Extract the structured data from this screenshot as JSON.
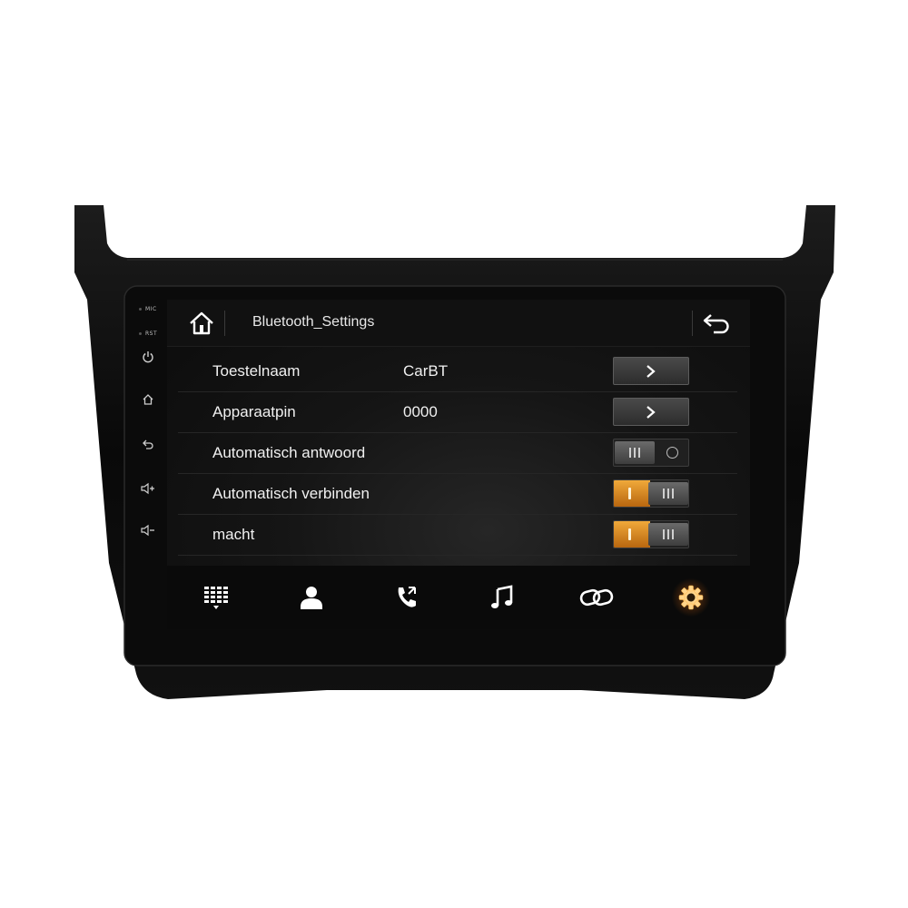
{
  "hardware_buttons": {
    "mic_label": "MIC",
    "rst_label": "RST"
  },
  "header": {
    "title": "Bluetooth_Settings",
    "home_icon": "home-icon",
    "back_icon": "back-arrow-icon"
  },
  "settings": [
    {
      "label": "Toestelnaam",
      "value": "CarBT",
      "control": "arrow"
    },
    {
      "label": "Apparaatpin",
      "value": "0000",
      "control": "arrow"
    },
    {
      "label": "Automatisch antwoord",
      "value": "",
      "control": "toggle",
      "state": "off"
    },
    {
      "label": "Automatisch verbinden",
      "value": "",
      "control": "toggle",
      "state": "on"
    },
    {
      "label": "macht",
      "value": "",
      "control": "toggle",
      "state": "on"
    }
  ],
  "bottom_nav": [
    {
      "icon": "dialpad-icon",
      "active": false
    },
    {
      "icon": "contacts-icon",
      "active": false
    },
    {
      "icon": "call-log-icon",
      "active": false
    },
    {
      "icon": "music-icon",
      "active": false
    },
    {
      "icon": "link-icon",
      "active": false
    },
    {
      "icon": "settings-gear-icon",
      "active": true
    }
  ],
  "colors": {
    "accent": "#e8962c",
    "screen_bg": "#141414",
    "text": "#f0f0f0"
  }
}
